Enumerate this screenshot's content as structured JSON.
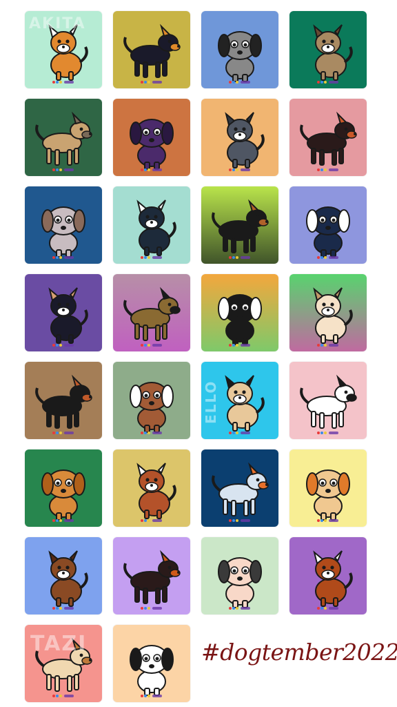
{
  "hashtag": "#dogtember2022",
  "tiles": [
    {
      "bg": "#b6ecd4",
      "body": "#e2892f",
      "accent": "#ffffff",
      "label": "AKITA"
    },
    {
      "bg": "#c8b446",
      "body": "#1a1a2a",
      "accent": "#e08a2a"
    },
    {
      "bg": "#6f97d9",
      "body": "#888888",
      "accent": "#222222"
    },
    {
      "bg": "#0b7a5a",
      "body": "#a98a62",
      "accent": "#6a4a32"
    },
    {
      "bg": "#2f6645",
      "body": "#c9a371",
      "accent": "#7a6a58"
    },
    {
      "bg": "#cd7441",
      "body": "#4b2a6b",
      "accent": "#2a1840"
    },
    {
      "bg": "#f1b571",
      "body": "#4f5663",
      "accent": "#303640"
    },
    {
      "bg": "#e59aa0",
      "body": "#2a1a1a",
      "accent": "#c8582a"
    },
    {
      "bg": "#20588f",
      "body": "#c8bcc0",
      "accent": "#8a6a5a"
    },
    {
      "bg": "#a4ddd1",
      "body": "#1d2a3a",
      "accent": "#ffffff"
    },
    {
      "bg": "#b9e44b",
      "bg2": "#40542a",
      "body": "#1a1a1a",
      "accent": "#b0622a"
    },
    {
      "bg": "#8e96de",
      "body": "#1a2a4a",
      "accent": "#ffffff"
    },
    {
      "bg": "#6a4ca3",
      "body": "#1a1a2a",
      "accent": "#d8a070"
    },
    {
      "bg": "#b78fa7",
      "bg2": "#c060c0",
      "body": "#8a6a32",
      "accent": "#1a1a1a"
    },
    {
      "bg": "#f3a73d",
      "bg2": "#7ec96a",
      "body": "#1a1a1a",
      "accent": "#ffffff"
    },
    {
      "bg": "#58d36e",
      "bg2": "#c06aa0",
      "body": "#f6e2c8",
      "accent": "#c49a6a"
    },
    {
      "bg": "#a47e57",
      "body": "#1a1a1a",
      "accent": "#c05a2a"
    },
    {
      "bg": "#8eac8a",
      "body": "#a25b36",
      "accent": "#ffffff"
    },
    {
      "bg": "#2ec6eb",
      "body": "#e8c89a",
      "accent": "#1a1a1a",
      "label": "ELLO"
    },
    {
      "bg": "#f4c3c9",
      "body": "#ffffff",
      "accent": "#1a1a1a"
    },
    {
      "bg": "#27864e",
      "body": "#d98a3a",
      "accent": "#b0601a"
    },
    {
      "bg": "#dcc56a",
      "body": "#b4522a",
      "accent": "#ffffff"
    },
    {
      "bg": "#0b3f70",
      "body": "#d8e4f0",
      "accent": "#e8702a"
    },
    {
      "bg": "#f8ee94",
      "body": "#f0c890",
      "accent": "#e07a2a"
    },
    {
      "bg": "#7ea2ee",
      "body": "#8a4a24",
      "accent": "#5a2a14"
    },
    {
      "bg": "#c49ff1",
      "body": "#2a1a1a",
      "accent": "#d05a1a"
    },
    {
      "bg": "#cbe7c8",
      "body": "#f8d8c8",
      "accent": "#3a3a3a"
    },
    {
      "bg": "#a068c8",
      "body": "#b04a1a",
      "accent": "#ffffff"
    },
    {
      "bg": "#f5948e",
      "body": "#f0d8b0",
      "accent": "#c07a3a",
      "label": "TAZI"
    },
    {
      "bg": "#fcd4a6",
      "body": "#ffffff",
      "accent": "#1a1a1a"
    }
  ]
}
